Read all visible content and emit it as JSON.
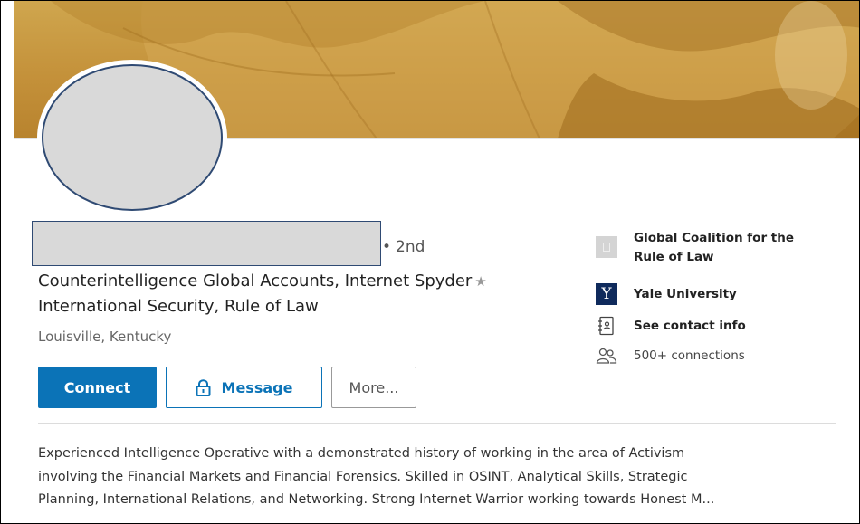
{
  "profile": {
    "degree": "2nd",
    "headline": "Counterintelligence Global Accounts, Internet Spyder",
    "headline_line2": "International Security, Rule of Law",
    "location": "Louisville, Kentucky"
  },
  "actions": {
    "connect_label": "Connect",
    "message_label": "Message",
    "more_label": "More..."
  },
  "sidebar": {
    "company": "Global Coalition for the Rule of Law",
    "school": "Yale University",
    "school_icon_letter": "Y",
    "contact_label": "See contact info",
    "connections": "500+ connections"
  },
  "summary": {
    "line1": "Experienced Intelligence Operative with a demonstrated history of working in the area of Activism",
    "line2": "involving the Financial Markets and Financial Forensics. Skilled in OSINT, Analytical Skills, Strategic",
    "line3": "Planning, International Relations, and Networking. Strong Internet Warrior working towards Honest M..."
  },
  "icons": {
    "headline_badge": "star-icon",
    "message": "lock-icon",
    "company": "company-logo-icon",
    "school": "yale-logo-icon",
    "contact": "contact-card-icon",
    "connections": "people-icon"
  },
  "colors": {
    "primary": "#0b73b7",
    "banner": "#c4913a",
    "yale_blue": "#0f2a5c"
  }
}
